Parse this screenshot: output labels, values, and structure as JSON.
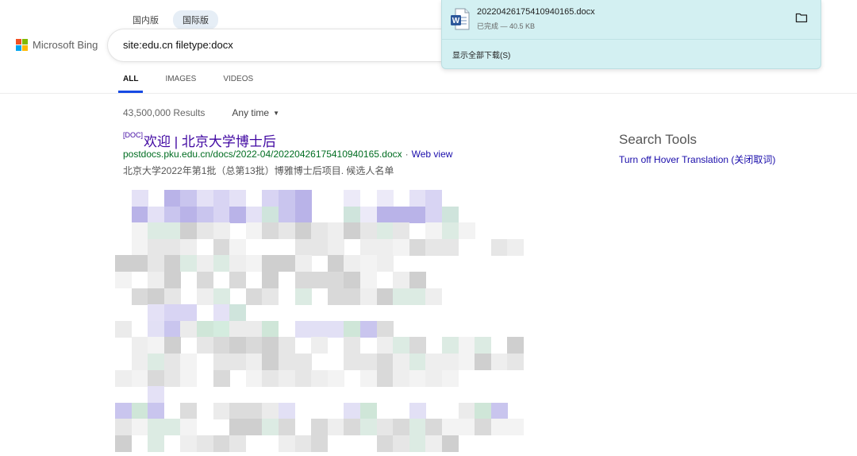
{
  "region": {
    "options": [
      "国内版",
      "国际版"
    ],
    "selected": "国际版"
  },
  "brand": {
    "name": "Microsoft Bing",
    "logo_colors": [
      "#f25022",
      "#7fba00",
      "#00a4ef",
      "#ffb900"
    ]
  },
  "search": {
    "query": "site:edu.cn filetype:docx"
  },
  "tabs": [
    {
      "label": "ALL",
      "active": true
    },
    {
      "label": "IMAGES",
      "active": false
    },
    {
      "label": "VIDEOS",
      "active": false
    }
  ],
  "results_meta": {
    "count": "43,500,000 Results",
    "time_filter": "Any time",
    "time_filter_icon": "caret-down-icon"
  },
  "results": [
    {
      "type_tag": "[DOC]",
      "title": "欢迎 | 北京大学博士后",
      "url": "postdocs.pku.edu.cn/docs/2022-04/20220426175410940165.docx",
      "separator": "·",
      "web_view": "Web view",
      "snippet": "北京大学2022年第1批（总第13批）博雅博士后项目. 候选人名单"
    }
  ],
  "side": {
    "heading": "Search Tools",
    "link": "Turn off Hover Translation (关闭取词)"
  },
  "download_panel": {
    "file_name": "20220426175410940165.docx",
    "status": "已完成 — 40.5 KB",
    "show_all": "显示全部下载(S)",
    "file_icon": "word-doc-icon",
    "folder_icon": "folder-icon"
  },
  "colors": {
    "link_title": "#4007a2",
    "url_green": "#006d21",
    "accent_blue": "#174ae4",
    "download_bg": "#d3f0f2"
  }
}
